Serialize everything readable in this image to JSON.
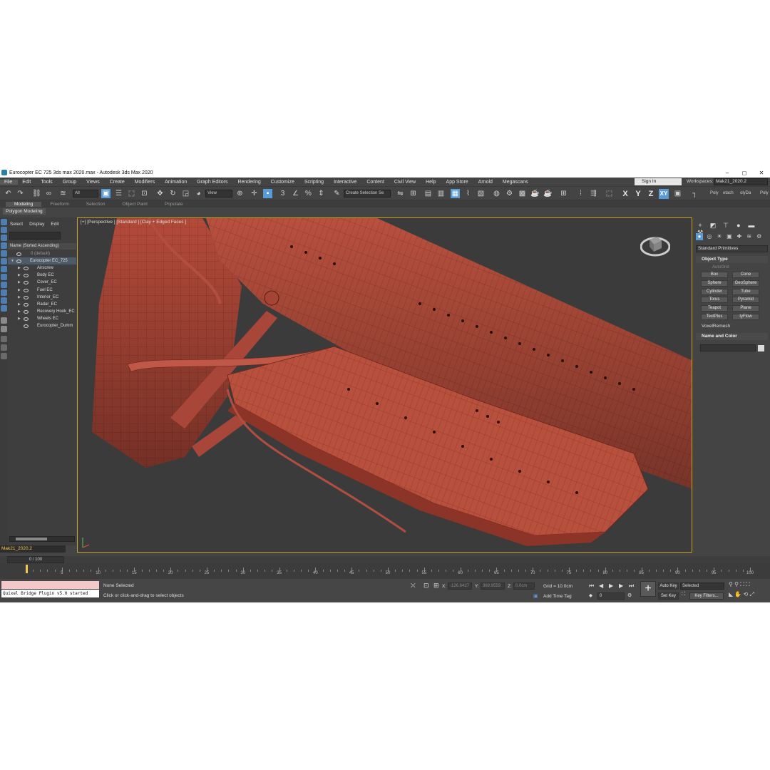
{
  "window": {
    "title": "Eurocopter EC 725 3ds max 2020.max - Autodesk 3ds Max 2020",
    "controls": [
      "–",
      "◻",
      "✕"
    ]
  },
  "menu": [
    "File",
    "Edit",
    "Tools",
    "Group",
    "Views",
    "Create",
    "Modifiers",
    "Animation",
    "Graph Editors",
    "Rendering",
    "Customize",
    "Scripting",
    "Interactive",
    "Content",
    "Civil View",
    "Help",
    "App Store",
    "Arnold",
    "Megascans"
  ],
  "signin": "Sign In",
  "workspaces": {
    "label": "Workspaces:",
    "value": "Mak21_2020.2"
  },
  "toolbar": {
    "filter": "All",
    "ref_coord": "View",
    "selection_set": "Create Selection Se",
    "axes": [
      "X",
      "Y",
      "Z",
      "XY"
    ],
    "right_texts": [
      "Poly",
      "etach",
      "olyDa",
      "Poly"
    ]
  },
  "ribbon": {
    "tabs": [
      "Modeling",
      "Freeform",
      "Selection",
      "Object Paint",
      "Populate"
    ],
    "active": "Modeling",
    "sub": "Polygon Modeling"
  },
  "explorer": {
    "menu": [
      "Select",
      "Display",
      "Edit"
    ],
    "header": "Name (Sorted Ascending)",
    "rows": [
      {
        "label": "0 (default)",
        "depth": 0,
        "dim": true
      },
      {
        "label": "Eurocopter EC_725",
        "depth": 0,
        "dim": false
      },
      {
        "label": "Airscrew",
        "depth": 1,
        "dim": false
      },
      {
        "label": "Body EC",
        "depth": 1,
        "dim": false
      },
      {
        "label": "Cover_EC",
        "depth": 1,
        "dim": false
      },
      {
        "label": "Fuel EC",
        "depth": 1,
        "dim": false
      },
      {
        "label": "Interior_EC",
        "depth": 1,
        "dim": false
      },
      {
        "label": "Radar_EC",
        "depth": 1,
        "dim": false
      },
      {
        "label": "Recovery Hook_EC",
        "depth": 1,
        "dim": false
      },
      {
        "label": "Wheels EC",
        "depth": 1,
        "dim": false
      },
      {
        "label": "Eurocopter_Dumm",
        "depth": 1,
        "dim": false
      }
    ],
    "layer": "Mak21_2020.2"
  },
  "viewport": {
    "label": "[+] [Perspective ] [Standard ] [Clay + Edged Faces ]",
    "model_color": "#b5483a"
  },
  "command_panel": {
    "dropdown": "Standard Primitives",
    "rollout_object_type": "Object Type",
    "autogrid": "AutoGrid",
    "buttons": [
      "Box",
      "Cone",
      "Sphere",
      "GeoSphere",
      "Cylinder",
      "Tube",
      "Torus",
      "Pyramid",
      "Teapot",
      "Plane",
      "TextPlus",
      "tyFlow"
    ],
    "extra": "VoxelRemesh",
    "rollout_name_color": "Name and Color"
  },
  "timeline": {
    "slider": "0 / 100",
    "ticks": [
      5,
      10,
      15,
      20,
      25,
      30,
      35,
      40,
      45,
      50,
      55,
      60,
      65,
      70,
      75,
      80,
      85,
      90,
      95,
      100
    ],
    "minor_count": 100
  },
  "status": {
    "maxscript": "Quixel Bridge Plugin v5.0 started",
    "selection": "None Selected",
    "prompt": "Click or click-and-drag to select objects",
    "x_label": "X:",
    "x_value": "-126.6427",
    "y_label": "Y:",
    "y_value": "369.9559",
    "z_label": "Z:",
    "z_value": "0.0cm",
    "grid": "Grid = 10.0cm",
    "add_time_tag": "Add Time Tag",
    "frame": "0",
    "auto_key": "Auto Key",
    "set_key": "Set Key",
    "selected": "Selected",
    "key_filters": "Key Filters..."
  }
}
